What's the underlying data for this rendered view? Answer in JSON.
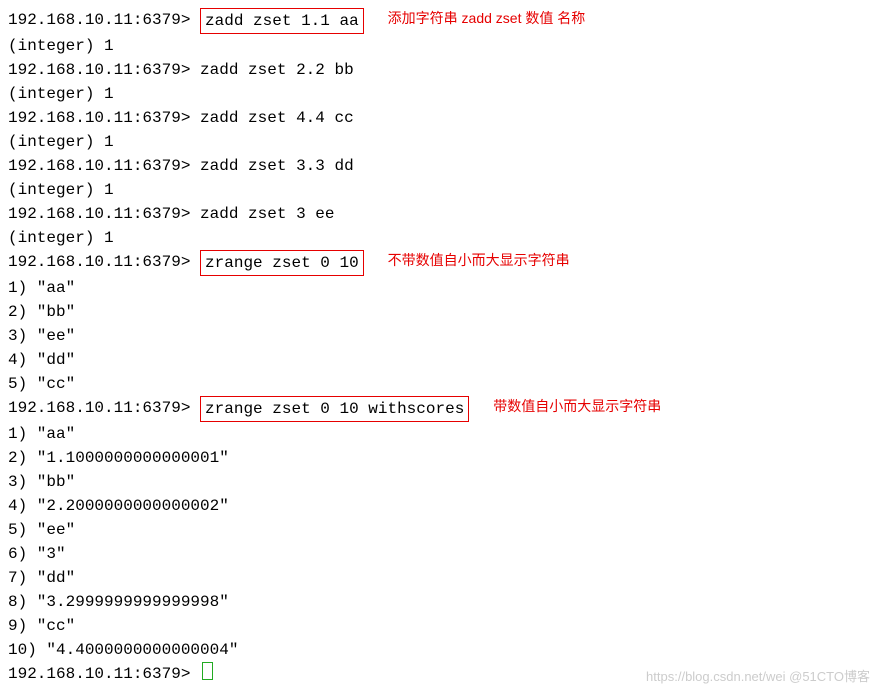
{
  "prompt": "192.168.10.11:6379>",
  "cmd1": {
    "text": "zadd zset 1.1 aa",
    "annotation": "添加字符串 zadd zset 数值 名称",
    "result": "(integer) 1"
  },
  "cmd2": {
    "text": "zadd zset 2.2 bb",
    "result": "(integer) 1"
  },
  "cmd3": {
    "text": "zadd zset 4.4 cc",
    "result": "(integer) 1"
  },
  "cmd4": {
    "text": "zadd zset 3.3 dd",
    "result": "(integer) 1"
  },
  "cmd5": {
    "text": "zadd zset 3 ee",
    "result": "(integer) 1"
  },
  "cmd6": {
    "text": "zrange zset 0 10",
    "annotation": "不带数值自小而大显示字符串"
  },
  "range1": {
    "r1": "1) \"aa\"",
    "r2": "2) \"bb\"",
    "r3": "3) \"ee\"",
    "r4": "4) \"dd\"",
    "r5": "5) \"cc\""
  },
  "cmd7": {
    "text": "zrange zset 0 10 withscores",
    "annotation": "带数值自小而大显示字符串"
  },
  "range2": {
    "r1": " 1) \"aa\"",
    "r2": " 2) \"1.1000000000000001\"",
    "r3": " 3) \"bb\"",
    "r4": " 4) \"2.2000000000000002\"",
    "r5": " 5) \"ee\"",
    "r6": " 6) \"3\"",
    "r7": " 7) \"dd\"",
    "r8": " 8) \"3.2999999999999998\"",
    "r9": " 9) \"cc\"",
    "r10": "10) \"4.4000000000000004\""
  },
  "watermark": "https://blog.csdn.net/wei @51CTO博客"
}
